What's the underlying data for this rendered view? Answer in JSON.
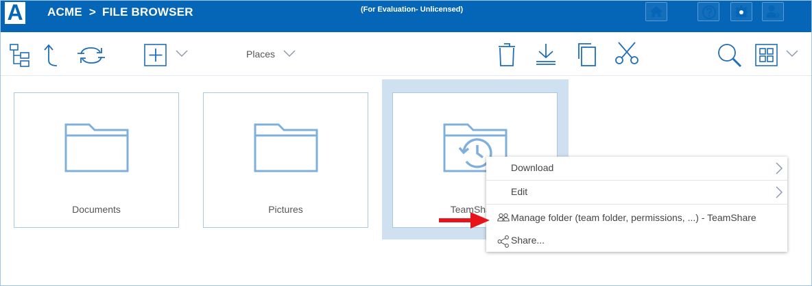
{
  "header": {
    "logo_letter": "A",
    "brand": "ACME",
    "separator": ">",
    "section": "FILE BROWSER",
    "evaluation": "(For Evaluation- Unlicensed)",
    "icons": [
      "home-icon",
      "help-icon",
      "gear-icon",
      "user-icon"
    ]
  },
  "toolbar": {
    "places_label": "Places",
    "left_icons": [
      "tree-icon",
      "up-folder-icon",
      "refresh-icon",
      "add-icon",
      "chevron-down-icon"
    ],
    "right_icons": [
      "trash-icon",
      "download-icon",
      "copy-icon",
      "cut-icon",
      "search-icon",
      "grid-view-icon",
      "chevron-down-icon"
    ]
  },
  "tiles": [
    {
      "label": "Documents",
      "icon": "folder-icon"
    },
    {
      "label": "Pictures",
      "icon": "folder-icon"
    },
    {
      "label": "TeamShare",
      "icon": "team-folder-icon",
      "selected": true
    }
  ],
  "context_menu": {
    "items": [
      {
        "label": "Download",
        "submenu": true
      },
      {
        "label": "Edit",
        "submenu": true
      },
      {
        "label": "Manage folder (team folder, permissions, ...) - TeamShare",
        "icon": "users-icon"
      },
      {
        "label": "Share...",
        "icon": "share-icon"
      }
    ]
  },
  "colors": {
    "header_bg": "#0565b7",
    "icon_blue": "#1f6db8",
    "folder_blue": "#7fb0dc",
    "selection_bg": "#cfe0f0",
    "arrow_red": "#e8141c"
  }
}
